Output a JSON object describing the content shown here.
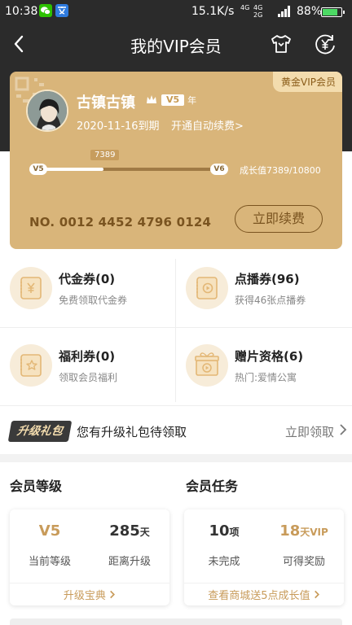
{
  "status_bar": {
    "time": "10:38",
    "net_speed": "15.1K/s",
    "sig1_top": "4G",
    "sig1_bottom": "",
    "sig2_top": "4G",
    "sig2_bottom": "2G",
    "battery": "88%",
    "battery_level": 0.88
  },
  "header": {
    "title": "我的VIP会员"
  },
  "card": {
    "badge": "黄金VIP会员",
    "username": "古镇古镇",
    "level_tag": "V5",
    "years_label": "年",
    "expire": "2020-11-16到期",
    "auto_renew": "开通自动续费>",
    "progress_current": "7389",
    "level_from": "V5",
    "level_to": "V6",
    "growth": "成长值7389/10800",
    "progress_fraction": 0.35,
    "card_no": "NO. 0012 4452 4796 0124",
    "renew_button": "立即续费"
  },
  "coupons": [
    {
      "title": "代金券(0)",
      "subtitle": "免费领取代金券",
      "icon": "voucher-yen-icon"
    },
    {
      "title": "点播券(96)",
      "subtitle": "获得46张点播券",
      "icon": "play-ticket-icon"
    },
    {
      "title": "福利券(0)",
      "subtitle": "领取会员福利",
      "icon": "star-ticket-icon"
    },
    {
      "title": "赠片资格(6)",
      "subtitle": "热门:爱情公寓",
      "icon": "gift-film-icon"
    }
  ],
  "upgrade": {
    "badge": "升级礼包",
    "text": "您有升级礼包待领取",
    "link": "立即领取"
  },
  "level_section": {
    "title": "会员等级",
    "stat1_value": "V5",
    "stat1_label": "当前等级",
    "stat2_value": "285",
    "stat2_unit": "天",
    "stat2_label": "距离升级",
    "link": "升级宝典"
  },
  "task_section": {
    "title": "会员任务",
    "stat1_value": "10",
    "stat1_unit": "项",
    "stat1_label": "未完成",
    "stat2_value": "18",
    "stat2_unit": "天VIP",
    "stat2_label": "可得奖励",
    "link": "查看商城送5点成长值"
  },
  "colors": {
    "dark": "#2b2b2b",
    "gold_card": "#d9b57a",
    "gold_text": "#c89b5a",
    "brown": "#7a5420"
  }
}
